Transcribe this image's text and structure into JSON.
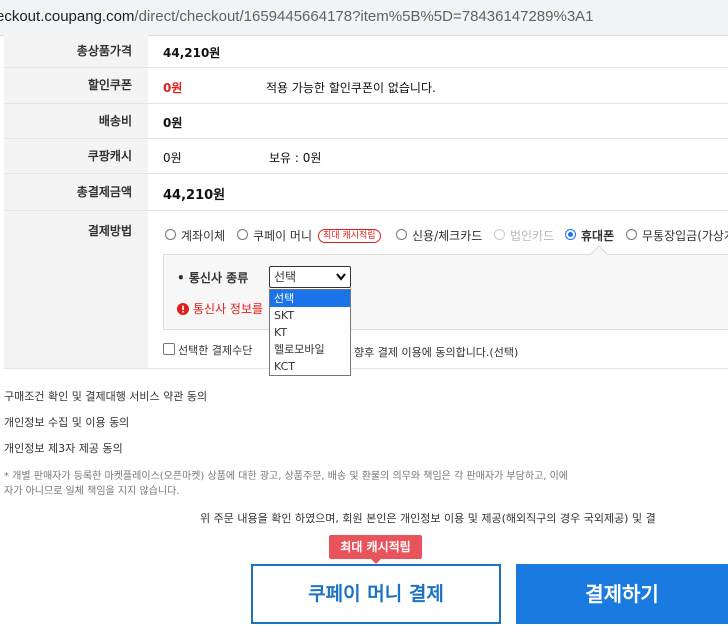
{
  "browser": {
    "url_host": "eckout.coupang.com",
    "url_path": "/direct/checkout/1659445664178?item%5B%5D=78436147289%3A1"
  },
  "summary": {
    "total_product_label": "총상품가격",
    "total_product_value": "44,210원",
    "coupon_label": "할인쿠폰",
    "coupon_value": "0원",
    "coupon_note": "적용 가능한 할인쿠폰이 없습니다.",
    "shipping_label": "배송비",
    "shipping_value": "0원",
    "cash_label": "쿠팡캐시",
    "cash_value": "0원",
    "cash_owned": "보유 : 0원",
    "grand_total_label": "총결제금액",
    "grand_total_value": "44,210원"
  },
  "payment": {
    "label": "결제방법",
    "methods": [
      {
        "label": "계좌이체",
        "selected": false
      },
      {
        "label": "쿠페이 머니",
        "selected": false,
        "badge": "최대 캐시적립"
      },
      {
        "label": "신용/체크카드",
        "selected": false
      },
      {
        "label": "법인카드",
        "selected": false,
        "disabled": true
      },
      {
        "label": "휴대폰",
        "selected": true
      },
      {
        "label": "무통장입금(가상계",
        "selected": false
      }
    ],
    "carrier_label": "통신사 종류",
    "carrier_selected": "선택",
    "carrier_options": [
      "선택",
      "SKT",
      "KT",
      "헬로모바일",
      "KCT"
    ],
    "carrier_error": "통신사 정보를",
    "agree_text_start": "선택한 결제수단",
    "agree_text_end": "향후 결제 이용에 동의합니다.(선택)"
  },
  "terms": [
    "구매조건 확인 및 결제대행 서비스 약관 동의",
    "개인정보 수집 및 이용 동의",
    "개인정보 제3자 제공 동의"
  ],
  "notice_line1": "* 개별 판매자가 등록한 마켓플레이스(오픈마켓) 상품에 대한 광고, 상품주문, 배송 및 환불의 의무와 책임은 각 판매자가 부담하고, 이에",
  "notice_line2": "자가 아니므로 일체 책임을 지지 않습니다.",
  "confirm_text": "위 주문 내용을 확인 하였으며, 회원 본인은 개인정보 이용 및 제공(해외직구의 경우 국외제공) 및 결",
  "cash_tooltip": "최대 캐시적립",
  "cash_button": "쿠페이 머니 결제",
  "pay_button": "결제하기"
}
